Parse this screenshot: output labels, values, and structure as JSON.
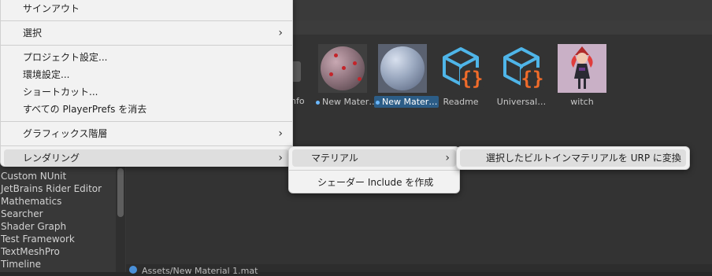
{
  "main_menu": {
    "items": [
      {
        "label": "サインアウト",
        "has_submenu": false
      },
      {
        "label": "選択",
        "has_submenu": true
      },
      {
        "label": "プロジェクト設定...",
        "has_submenu": false
      },
      {
        "label": "環境設定...",
        "has_submenu": false
      },
      {
        "label": "ショートカット...",
        "has_submenu": false
      },
      {
        "label": "すべての PlayerPrefs を消去",
        "has_submenu": false
      },
      {
        "label": "グラフィックス階層",
        "has_submenu": true
      },
      {
        "label": "レンダリング",
        "has_submenu": true
      }
    ],
    "arrow_glyph": "›"
  },
  "render_submenu": {
    "items": [
      {
        "label": "マテリアル",
        "has_submenu": true
      },
      {
        "label": "シェーダー Include を作成",
        "has_submenu": false
      }
    ]
  },
  "material_submenu": {
    "items": [
      {
        "label": "選択したビルトインマテリアルを URP に変換"
      }
    ]
  },
  "packages": [
    "Custom NUnit",
    "JetBrains Rider Editor",
    "Mathematics",
    "Searcher",
    "Shader Graph",
    "Test Framework",
    "TextMeshPro",
    "Timeline"
  ],
  "assets": [
    {
      "label": "New Mater…",
      "type": "material",
      "color": "red",
      "selected": false,
      "modified": true
    },
    {
      "label": "New Mater…",
      "type": "material",
      "color": "blue",
      "selected": true,
      "modified": true
    },
    {
      "label": "Readme",
      "type": "script",
      "selected": false,
      "modified": false
    },
    {
      "label": "Universal…",
      "type": "script",
      "selected": false,
      "modified": false
    },
    {
      "label": "witch",
      "type": "image",
      "selected": false,
      "modified": false
    }
  ],
  "partial_labels": {
    "info": "nfo"
  },
  "status": {
    "path": "Assets/New Material 1.mat"
  },
  "colors": {
    "menu_bg": "#f2f2f2",
    "highlight": "#dedede",
    "selection_blue": "#2c5d87",
    "script_icon_blue": "#4fb5e8",
    "script_icon_orange": "#f06b2a"
  }
}
